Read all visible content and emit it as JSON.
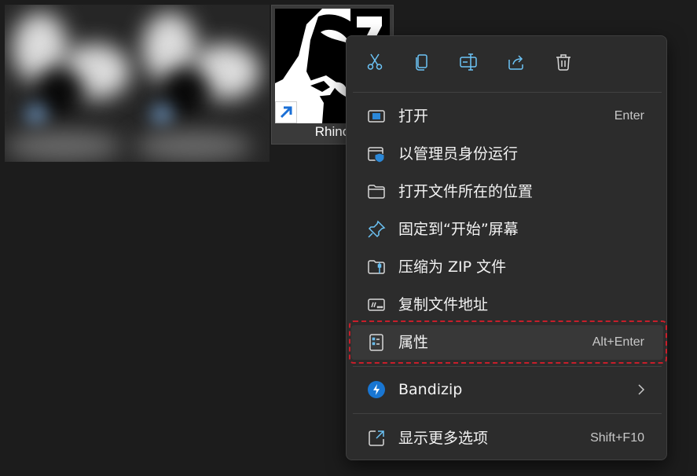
{
  "desktop": {
    "shortcut": {
      "label": "Rhino",
      "badge": "7"
    }
  },
  "context_menu": {
    "toolbar": [
      {
        "name": "cut",
        "icon": "scissors-icon"
      },
      {
        "name": "copy",
        "icon": "copy-icon"
      },
      {
        "name": "rename",
        "icon": "rename-icon"
      },
      {
        "name": "share",
        "icon": "share-icon"
      },
      {
        "name": "delete",
        "icon": "trash-icon"
      }
    ],
    "items": [
      {
        "label": "打开",
        "shortcut": "Enter",
        "icon": "open-app-icon"
      },
      {
        "label": "以管理员身份运行",
        "shortcut": "",
        "icon": "run-as-admin-shield-icon"
      },
      {
        "label": "打开文件所在的位置",
        "shortcut": "",
        "icon": "folder-icon"
      },
      {
        "label": "固定到“开始”屏幕",
        "shortcut": "",
        "icon": "pin-icon"
      },
      {
        "label": "压缩为 ZIP 文件",
        "shortcut": "",
        "icon": "zip-folder-icon"
      },
      {
        "label": "复制文件地址",
        "shortcut": "",
        "icon": "copy-path-icon"
      },
      {
        "label": "属性",
        "shortcut": "Alt+Enter",
        "icon": "properties-icon",
        "highlighted": true
      },
      {
        "label": "Bandizip",
        "shortcut": "",
        "icon": "bandizip-icon",
        "submenu": true
      },
      {
        "label": "显示更多选项",
        "shortcut": "Shift+F10",
        "icon": "more-options-icon"
      }
    ]
  },
  "colors": {
    "menu_bg": "#2c2c2c",
    "accent_icon": "#6cc4f7",
    "highlight_border": "#c81e2a",
    "bandizip_blue": "#1976d2"
  }
}
